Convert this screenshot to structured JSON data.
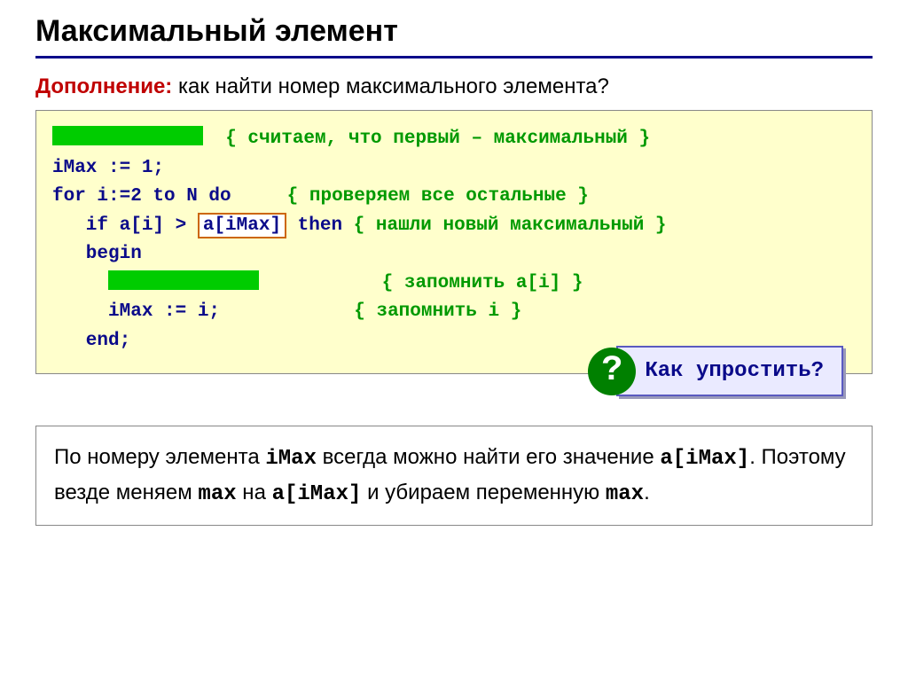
{
  "title": "Максимальный элемент",
  "question": {
    "prefix": "Дополнение:",
    "text": "как найти номер максимального элемента?"
  },
  "code": {
    "c1_comment": "{ считаем, что первый – максимальный }",
    "l2": "iMax := 1;",
    "l3a": "for i:=2 to N do     ",
    "l3b": "{ проверяем все остальные }",
    "l4a": "   if a[i] > ",
    "l4_hl": "a[iMax]",
    "l4b": " then ",
    "l4c": "{ нашли новый максимальный }",
    "l5": "   begin",
    "l6_comment": "{ запомнить a[i] }",
    "l7a": "     iMax := i;            ",
    "l7b": "{ запомнить i }",
    "l8": "   end;"
  },
  "callout": "Как упростить?",
  "explain": {
    "t1": "По номеру элемента ",
    "m1": "iMax",
    "t2": " всегда можно найти его значение ",
    "m2": "a[iMax]",
    "t3": ". Поэтому везде меняем ",
    "m3": "max",
    "t4": " на ",
    "m4": "a[iMax]",
    "t5": " и убираем переменную ",
    "m5": "max",
    "t6": "."
  }
}
